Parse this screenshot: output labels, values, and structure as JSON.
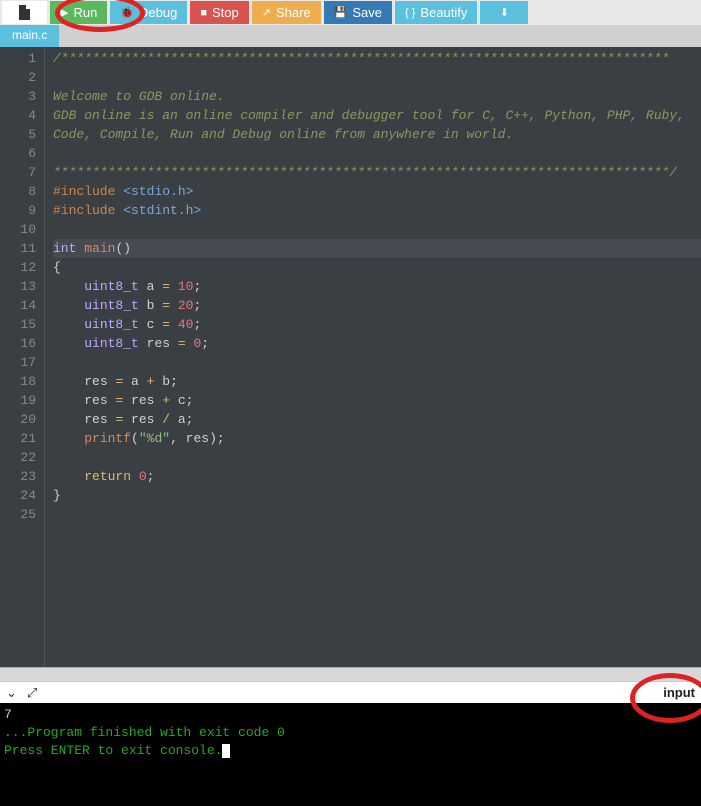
{
  "toolbar": {
    "run": "Run",
    "debug": "Debug",
    "stop": "Stop",
    "share": "Share",
    "save": "Save",
    "beautify": "Beautify"
  },
  "tab": {
    "name": "main.c"
  },
  "editor": {
    "lines": [
      {
        "n": 1,
        "html": "<span class='c-comment'>/******************************************************************************</span>"
      },
      {
        "n": 2,
        "html": "<span class='c-comment'></span>"
      },
      {
        "n": 3,
        "html": "<span class='c-comment'>Welcome to GDB online.</span>"
      },
      {
        "n": 4,
        "html": "<span class='c-comment'>GDB online is an online compiler and debugger tool for C, C++, Python, PHP, Ruby,</span>"
      },
      {
        "n": 5,
        "html": "<span class='c-comment'>Code, Compile, Run and Debug online from anywhere in world.</span>"
      },
      {
        "n": 6,
        "html": "<span class='c-comment'></span>"
      },
      {
        "n": 7,
        "html": "<span class='c-comment'>*******************************************************************************/</span>"
      },
      {
        "n": 8,
        "html": "<span class='c-preproc'>#include</span> <span class='c-include'>&lt;stdio.h&gt;</span>"
      },
      {
        "n": 9,
        "html": "<span class='c-preproc'>#include</span> <span class='c-include'>&lt;stdint.h&gt;</span>"
      },
      {
        "n": 10,
        "html": ""
      },
      {
        "n": 11,
        "html": "<span class='c-type'>int</span> <span class='c-func'>main</span><span class='c-plain'>()</span>",
        "current": true
      },
      {
        "n": 12,
        "html": "<span class='c-plain'>{</span>"
      },
      {
        "n": 13,
        "html": "    <span class='c-type'>uint8_t</span> <span class='c-plain'>a </span><span class='c-op'>=</span> <span class='c-num'>10</span><span class='c-plain'>;</span>"
      },
      {
        "n": 14,
        "html": "    <span class='c-type'>uint8_t</span> <span class='c-plain'>b </span><span class='c-op'>=</span> <span class='c-num'>20</span><span class='c-plain'>;</span>"
      },
      {
        "n": 15,
        "html": "    <span class='c-type'>uint8_t</span> <span class='c-plain'>c </span><span class='c-op'>=</span> <span class='c-num'>40</span><span class='c-plain'>;</span>"
      },
      {
        "n": 16,
        "html": "    <span class='c-type'>uint8_t</span> <span class='c-plain'>res </span><span class='c-op'>=</span> <span class='c-num'>0</span><span class='c-plain'>;</span>"
      },
      {
        "n": 17,
        "html": ""
      },
      {
        "n": 18,
        "html": "    <span class='c-plain'>res </span><span class='c-op'>=</span><span class='c-plain'> a </span><span class='c-op'>+</span><span class='c-plain'> b;</span>"
      },
      {
        "n": 19,
        "html": "    <span class='c-plain'>res </span><span class='c-op'>=</span><span class='c-plain'> res </span><span class='c-op'>+</span><span class='c-plain'> c;</span>"
      },
      {
        "n": 20,
        "html": "    <span class='c-plain'>res </span><span class='c-op'>=</span><span class='c-plain'> res </span><span class='c-op'>/</span><span class='c-plain'> a;</span>"
      },
      {
        "n": 21,
        "html": "    <span class='c-func'>printf</span><span class='c-plain'>(</span><span class='c-string'>\"%d\"</span><span class='c-plain'>, res);</span>"
      },
      {
        "n": 22,
        "html": ""
      },
      {
        "n": 23,
        "html": "    <span class='c-keyword'>return</span> <span class='c-num'>0</span><span class='c-plain'>;</span>"
      },
      {
        "n": 24,
        "html": "<span class='c-plain'>}</span>"
      },
      {
        "n": 25,
        "html": ""
      }
    ]
  },
  "console": {
    "input_label": "input",
    "output_value": "7",
    "line_blank": "",
    "finished": "...Program finished with exit code 0",
    "prompt": "Press ENTER to exit console."
  }
}
